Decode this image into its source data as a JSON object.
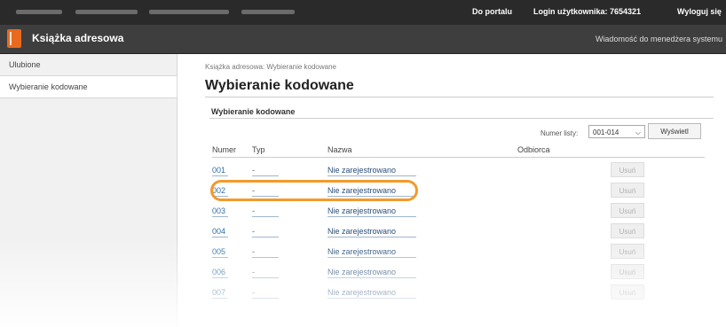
{
  "topbar": {
    "portal_link": "Do portalu",
    "login_label": "Login użytkownika: 7654321",
    "logout_link": "Wyloguj się"
  },
  "app": {
    "title": "Książka adresowa",
    "message_link": "Wiadomość do menedżera systemu"
  },
  "sidebar": {
    "items": [
      {
        "label": "Ulubione"
      },
      {
        "label": "Wybieranie kodowane"
      }
    ]
  },
  "breadcrumb": "Książka adresowa: Wybieranie kodowane",
  "page_title": "Wybieranie kodowane",
  "section_title": "Wybieranie kodowane",
  "list_filter": {
    "label": "Numer listy:",
    "value": "001-014",
    "button": "Wyświetl"
  },
  "table": {
    "headers": [
      "Numer",
      "Typ",
      "Nazwa",
      "Odbiorca"
    ],
    "rows": [
      {
        "number": "001",
        "type": "-",
        "name": "Nie zarejestrowano",
        "delete": "Usuń"
      },
      {
        "number": "002",
        "type": "-",
        "name": "Nie zarejestrowano",
        "delete": "Usuń"
      },
      {
        "number": "003",
        "type": "-",
        "name": "Nie zarejestrowano",
        "delete": "Usuń"
      },
      {
        "number": "004",
        "type": "-",
        "name": "Nie zarejestrowano",
        "delete": "Usuń"
      },
      {
        "number": "005",
        "type": "-",
        "name": "Nie zarejestrowano",
        "delete": "Usuń"
      },
      {
        "number": "006",
        "type": "-",
        "name": "Nie zarejestrowano",
        "delete": "Usuń"
      },
      {
        "number": "007",
        "type": "-",
        "name": "Nie zarejestrowano",
        "delete": "Usuń"
      }
    ]
  },
  "colors": {
    "accent": "#e96a1f",
    "highlight": "#f39a2a",
    "link": "#2f6ea8"
  },
  "icons": {
    "app_icon": "address-book-icon",
    "dropdown": "chevron-down-icon"
  }
}
